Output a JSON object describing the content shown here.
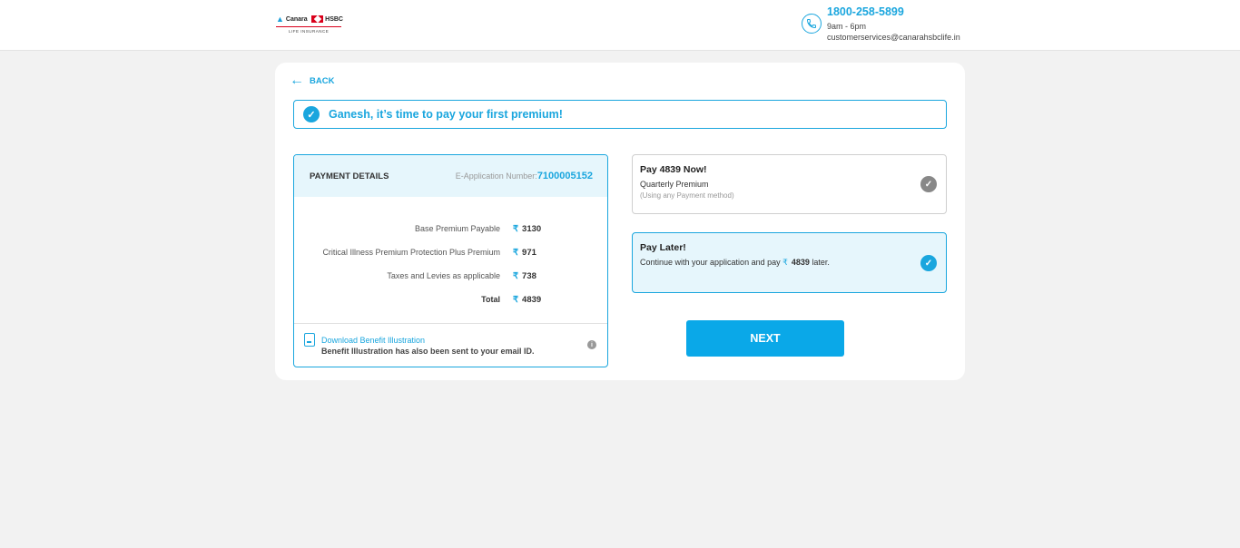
{
  "header": {
    "logo": {
      "brand_left": "Canara",
      "brand_right": "HSBC",
      "subtitle": "LIFE INSURANCE"
    },
    "contact": {
      "icon": "phone-icon",
      "phone": "1800-258-5899",
      "hours": "9am - 6pm",
      "email": "customerservices@canarahsbclife.in"
    }
  },
  "back": {
    "icon": "arrow-left-icon",
    "label": "BACK"
  },
  "greeting": {
    "icon": "check-circle-icon",
    "text": "Ganesh, it’s time to pay your first premium!"
  },
  "payment_details": {
    "title": "PAYMENT DETAILS",
    "app_label": "E-Application Number:",
    "app_number": "7100005152",
    "currency_symbol": "₹",
    "rows": [
      {
        "label": "Base Premium Payable",
        "value": "3130"
      },
      {
        "label": "Critical Illness Premium Protection Plus Premium",
        "value": "971"
      },
      {
        "label": "Taxes and Levies as applicable",
        "value": "738"
      },
      {
        "label": "Total",
        "value": "4839"
      }
    ],
    "download_link": "Download Benefit Illustration",
    "download_note": "Benefit Illustration has also been sent to your email ID."
  },
  "options": {
    "pay_now": {
      "title": "Pay 4839 Now!",
      "line2": "Quarterly Premium",
      "line3": "(Using any Payment method)",
      "selected": false
    },
    "pay_later": {
      "title": "Pay Later!",
      "text_before": "Continue with your application and pay ",
      "currency_symbol": "₹",
      "amount": "4839",
      "text_after": " later.",
      "selected": true
    }
  },
  "next_button": {
    "label": "NEXT"
  },
  "colors": {
    "accent": "#1aa6de",
    "button": "#0aa8e8",
    "selected_bg": "#e6f6fc",
    "page_bg": "#f2f2f2"
  }
}
